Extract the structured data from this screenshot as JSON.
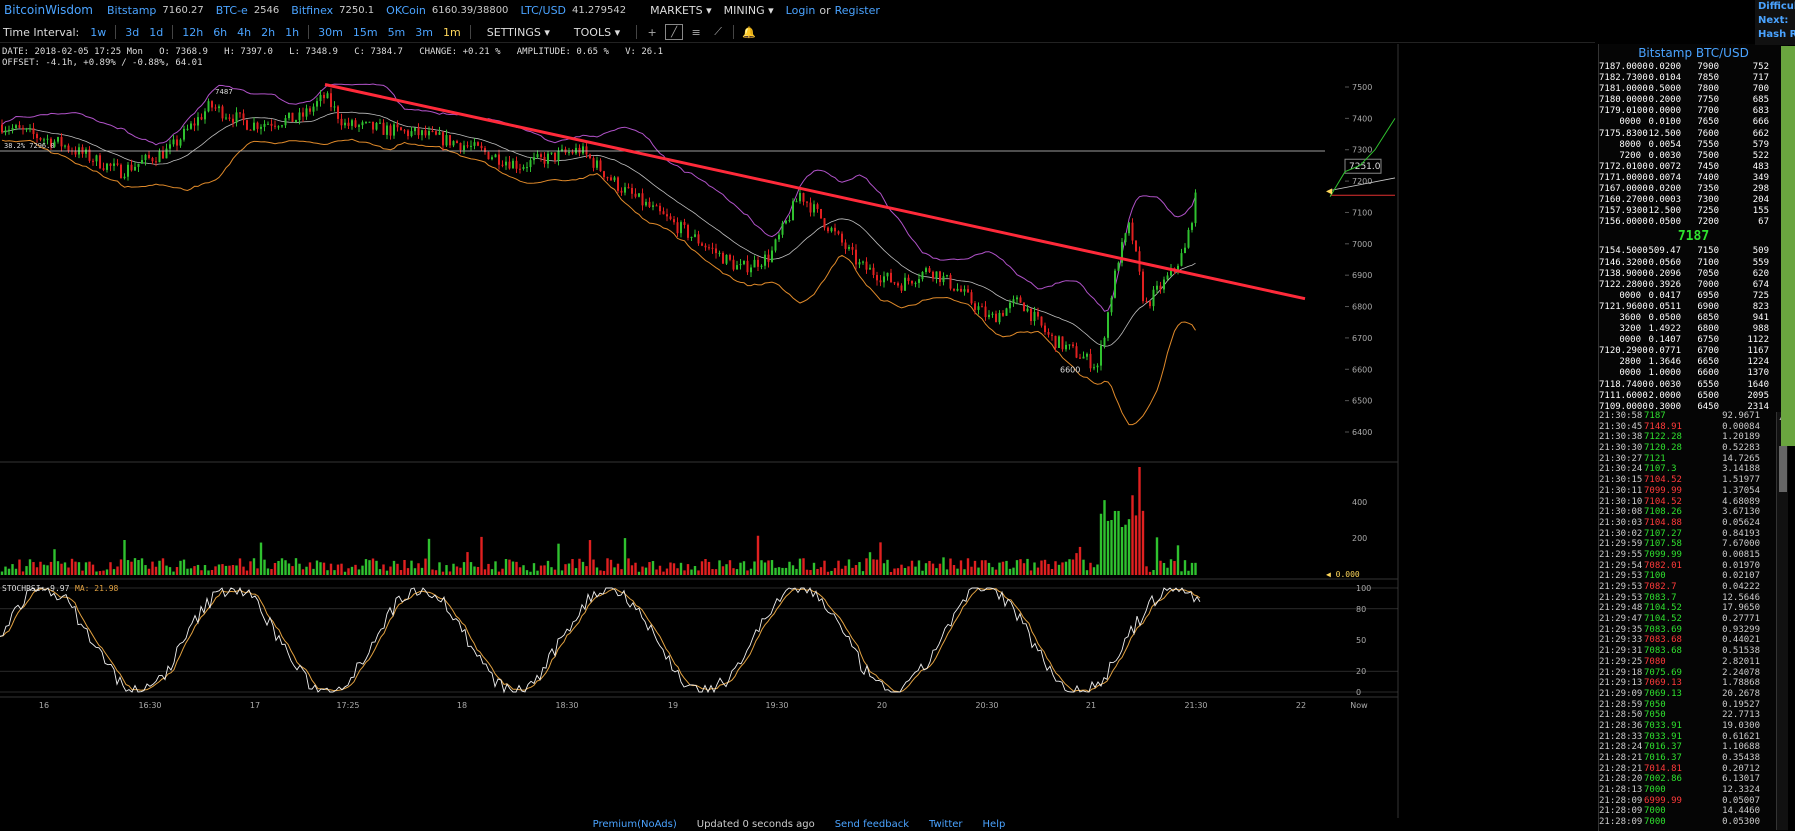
{
  "topbar": {
    "logo": "BitcoinWisdom",
    "markets": [
      {
        "name": "Bitstamp",
        "price": "7160.27"
      },
      {
        "name": "BTC-e",
        "price": "2546"
      },
      {
        "name": "Bitfinex",
        "price": "7250.1"
      },
      {
        "name": "OKCoin",
        "price": "6160.39/38800"
      },
      {
        "name": "LTC/USD",
        "price": "41.279542"
      }
    ],
    "menu_markets": "MARKETS",
    "menu_mining": "MINING",
    "login": "Login",
    "or": "or",
    "register": "Register"
  },
  "toolbar": {
    "label": "Time Interval:",
    "intervals": [
      "1w",
      "3d",
      "1d",
      "12h",
      "6h",
      "4h",
      "2h",
      "1h",
      "30m",
      "15m",
      "5m",
      "3m",
      "1m"
    ],
    "active_interval": "1m",
    "settings": "SETTINGS",
    "tools": "TOOLS",
    "icons": [
      "crosshair-icon",
      "line-icon",
      "hline-icon",
      "fib-icon",
      "bell-icon"
    ]
  },
  "info": {
    "line1": "DATE: 2018-02-05 17:25 Mon   O: 7368.9   H: 7397.0   L: 7348.9   C: 7384.7   CHANGE: +0.21 %   AMPLITUDE: 0.65 %   V: 26.1",
    "line2": "OFFSET: -4.1h, +0.89% / -0.88%, 64.01"
  },
  "chart_data": {
    "type": "candlestick",
    "price_axis": [
      "7500",
      "7400",
      "7300",
      "7200",
      "7100",
      "7000",
      "6900",
      "6800",
      "6700",
      "6600",
      "6500",
      "6400"
    ],
    "price_range": [
      6350,
      7560
    ],
    "volume_axis": [
      "400",
      "200"
    ],
    "stoch_axis": [
      "100",
      "80",
      "50",
      "20",
      "0"
    ],
    "time_axis": [
      "16",
      "16:30",
      "17",
      "17:25",
      "18",
      "18:30",
      "19",
      "19:30",
      "20",
      "20:30",
      "21",
      "21:30",
      "22",
      "Now"
    ],
    "price_tag": "7251.0",
    "peak_label": "7487",
    "trough_label": "6600",
    "fib_label": "38.2% 7296.0",
    "fib_level": 7296,
    "volume_zero": "0.000",
    "stoch_label": "STOCHRSI: 9.97",
    "ma_label": "MA: 21.98",
    "trendline": {
      "start": [
        325,
        7508
      ],
      "end": [
        1305,
        6825
      ]
    },
    "colors": {
      "up": "#2fc12f",
      "down": "#e02020",
      "trend": "#ff2a3a",
      "band_upper": "#b052c8",
      "band_lower": "#e08a2a",
      "mid": "#bdbdbd",
      "stoch": "#f0f0f0",
      "stoch_ma": "#e0a040"
    }
  },
  "sidebar": {
    "title": "Bitstamp BTC/USD",
    "asks": [
      [
        "7187.0000",
        "0.0200",
        "7900",
        "752"
      ],
      [
        "7182.7300",
        "0.0104",
        "7850",
        "717"
      ],
      [
        "7181.0000",
        "0.5000",
        "7800",
        "700"
      ],
      [
        "7180.0000",
        "0.2000",
        "7750",
        "685"
      ],
      [
        "7179.0100",
        "0.0000",
        "7700",
        "683"
      ],
      [
        "0000",
        "0.0100",
        "7650",
        "666"
      ],
      [
        "7175.8300",
        "12.500",
        "7600",
        "662"
      ],
      [
        "8000",
        "0.0054",
        "7550",
        "579"
      ],
      [
        "7200",
        "0.0030",
        "7500",
        "522"
      ],
      [
        "7172.0100",
        "0.0072",
        "7450",
        "483"
      ],
      [
        "7171.0000",
        "0.0074",
        "7400",
        "349"
      ],
      [
        "7167.0000",
        "0.0200",
        "7350",
        "298"
      ],
      [
        "7160.2700",
        "0.0003",
        "7300",
        "204"
      ],
      [
        "7157.9300",
        "12.500",
        "7250",
        "155"
      ],
      [
        "7156.0000",
        "0.0500",
        "7200",
        "67"
      ]
    ],
    "last_price": "7187",
    "bids": [
      [
        "7154.5000",
        "509.47",
        "7150",
        "509"
      ],
      [
        "7146.3200",
        "0.0560",
        "7100",
        "559"
      ],
      [
        "7138.9000",
        "0.2096",
        "7050",
        "620"
      ],
      [
        "7122.2800",
        "0.3926",
        "7000",
        "674"
      ],
      [
        "0000",
        "0.0417",
        "6950",
        "725"
      ],
      [
        "7121.9600",
        "0.0511",
        "6900",
        "823"
      ],
      [
        "3600",
        "0.0500",
        "6850",
        "941"
      ],
      [
        "3200",
        "1.4922",
        "6800",
        "988"
      ],
      [
        "0000",
        "0.1407",
        "6750",
        "1122"
      ],
      [
        "7120.2900",
        "0.0771",
        "6700",
        "1167"
      ],
      [
        "2800",
        "1.3646",
        "6650",
        "1224"
      ],
      [
        "0000",
        "1.0000",
        "6600",
        "1370"
      ],
      [
        "7118.7400",
        "0.0030",
        "6550",
        "1640"
      ],
      [
        "7111.6000",
        "2.0000",
        "6500",
        "2095"
      ],
      [
        "7109.0000",
        "0.3000",
        "6450",
        "2314"
      ]
    ],
    "trades": [
      [
        "21:30:58",
        "7187",
        "up",
        "92.9671"
      ],
      [
        "21:30:45",
        "7148.91",
        "dn",
        "0.00084"
      ],
      [
        "21:30:38",
        "7122.28",
        "up",
        "1.20189"
      ],
      [
        "21:30:30",
        "7120.28",
        "up",
        "0.52283"
      ],
      [
        "21:30:27",
        "7121",
        "up",
        "14.7265"
      ],
      [
        "21:30:24",
        "7107.3",
        "up",
        "3.14188"
      ],
      [
        "21:30:15",
        "7104.52",
        "dn",
        "1.51977"
      ],
      [
        "21:30:11",
        "7099.99",
        "dn",
        "1.37054"
      ],
      [
        "21:30:10",
        "7104.52",
        "dn",
        "4.68089"
      ],
      [
        "21:30:08",
        "7108.26",
        "up",
        "3.67130"
      ],
      [
        "21:30:03",
        "7104.88",
        "dn",
        "0.05624"
      ],
      [
        "21:30:02",
        "7107.27",
        "up",
        "0.84193"
      ],
      [
        "21:29:59",
        "7107.58",
        "up",
        "7.67000"
      ],
      [
        "21:29:55",
        "7099.99",
        "up",
        "0.00815"
      ],
      [
        "21:29:54",
        "7082.01",
        "dn",
        "0.01970"
      ],
      [
        "21:29:53",
        "7100",
        "up",
        "0.02107"
      ],
      [
        "21:29:53",
        "7082.7",
        "dn",
        "0.04222"
      ],
      [
        "21:29:53",
        "7083.7",
        "up",
        "12.5646"
      ],
      [
        "21:29:48",
        "7104.52",
        "up",
        "17.9650"
      ],
      [
        "21:29:47",
        "7104.52",
        "up",
        "0.27771"
      ],
      [
        "21:29:35",
        "7083.69",
        "up",
        "0.93299"
      ],
      [
        "21:29:33",
        "7083.68",
        "dn",
        "0.44021"
      ],
      [
        "21:29:31",
        "7083.68",
        "up",
        "0.51538"
      ],
      [
        "21:29:25",
        "7080",
        "dn",
        "2.82011"
      ],
      [
        "21:29:18",
        "7075.69",
        "up",
        "2.24078"
      ],
      [
        "21:29:13",
        "7069.13",
        "dn",
        "1.78868"
      ],
      [
        "21:29:09",
        "7069.13",
        "up",
        "20.2678"
      ],
      [
        "21:28:59",
        "7050",
        "up",
        "0.19527"
      ],
      [
        "21:28:50",
        "7050",
        "up",
        "22.7713"
      ],
      [
        "21:28:36",
        "7033.91",
        "up",
        "19.0300"
      ],
      [
        "21:28:33",
        "7033.91",
        "up",
        "0.61621"
      ],
      [
        "21:28:24",
        "7016.37",
        "up",
        "1.10688"
      ],
      [
        "21:28:21",
        "7016.37",
        "up",
        "0.35438"
      ],
      [
        "21:28:21",
        "7014.81",
        "dn",
        "0.20712"
      ],
      [
        "21:28:20",
        "7002.86",
        "up",
        "6.13017"
      ],
      [
        "21:28:13",
        "7000",
        "up",
        "12.3324"
      ],
      [
        "21:28:09",
        "6999.99",
        "dn",
        "0.05007"
      ],
      [
        "21:28:09",
        "7000",
        "up",
        "14.4460"
      ],
      [
        "21:28:09",
        "7000",
        "up",
        "0.05300"
      ]
    ]
  },
  "rightpanel": {
    "difficulty": "Difficulty:",
    "next": "Next:",
    "hashrate": "Hash Rate:"
  },
  "footer": {
    "premium": "Premium(NoAds)",
    "updated": "Updated 0 seconds ago",
    "feedback": "Send feedback",
    "twitter": "Twitter",
    "help": "Help"
  }
}
